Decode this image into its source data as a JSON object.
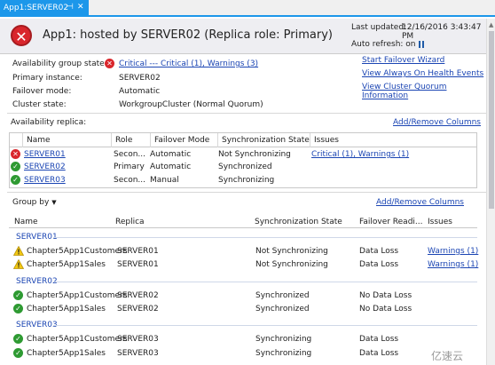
{
  "tab": {
    "title": "App1:SERVER02",
    "pin": "⊣",
    "close": "✕"
  },
  "header": {
    "title": "App1: hosted by SERVER02 (Replica role: Primary)",
    "last_updated_label": "Last updated:",
    "last_updated_value": "12/16/2016 3:43:47 PM",
    "auto_refresh_label": "Auto refresh: on"
  },
  "summary": {
    "ag_state_label": "Availability group state:",
    "ag_state_value": "Critical --- Critical (1), Warnings (3)",
    "primary_label": "Primary instance:",
    "primary_value": "SERVER02",
    "failover_label": "Failover mode:",
    "failover_value": "Automatic",
    "cluster_label": "Cluster state:",
    "cluster_value": "WorkgroupCluster (Normal Quorum)"
  },
  "links": {
    "wizard": "Start Failover Wizard",
    "health": "View Always On Health Events",
    "quorum": "View Cluster Quorum Information"
  },
  "replica_section": {
    "title": "Availability replica:",
    "add_remove": "Add/Remove Columns",
    "columns": [
      "Name",
      "Role",
      "Failover Mode",
      "Synchronization State",
      "Issues"
    ],
    "rows": [
      {
        "status": "error",
        "name": "SERVER01",
        "role": "Secon...",
        "failover": "Automatic",
        "sync": "Not Synchronizing",
        "issues": "Critical (1), Warnings (1)"
      },
      {
        "status": "ok",
        "name": "SERVER02",
        "role": "Primary",
        "failover": "Automatic",
        "sync": "Synchronized",
        "issues": ""
      },
      {
        "status": "ok",
        "name": "SERVER03",
        "role": "Secon...",
        "failover": "Manual",
        "sync": "Synchronizing",
        "issues": ""
      }
    ]
  },
  "db_section": {
    "group_by": "Group by",
    "add_remove": "Add/Remove Columns",
    "columns": [
      "Name",
      "Replica",
      "Synchronization State",
      "Failover Readi...",
      "Issues"
    ],
    "groups": [
      {
        "label": "SERVER01",
        "rows": [
          {
            "status": "warn",
            "name": "Chapter5App1Customers",
            "replica": "SERVER01",
            "sync": "Not Synchronizing",
            "failover": "Data Loss",
            "issues": "Warnings (1)"
          },
          {
            "status": "warn",
            "name": "Chapter5App1Sales",
            "replica": "SERVER01",
            "sync": "Not Synchronizing",
            "failover": "Data Loss",
            "issues": "Warnings (1)"
          }
        ]
      },
      {
        "label": "SERVER02",
        "rows": [
          {
            "status": "ok",
            "name": "Chapter5App1Customers",
            "replica": "SERVER02",
            "sync": "Synchronized",
            "failover": "No Data Loss",
            "issues": ""
          },
          {
            "status": "ok",
            "name": "Chapter5App1Sales",
            "replica": "SERVER02",
            "sync": "Synchronized",
            "failover": "No Data Loss",
            "issues": ""
          }
        ]
      },
      {
        "label": "SERVER03",
        "rows": [
          {
            "status": "ok",
            "name": "Chapter5App1Customers",
            "replica": "SERVER03",
            "sync": "Synchronizing",
            "failover": "Data Loss",
            "issues": ""
          },
          {
            "status": "ok",
            "name": "Chapter5App1Sales",
            "replica": "SERVER03",
            "sync": "Synchronizing",
            "failover": "Data Loss",
            "issues": ""
          }
        ]
      }
    ]
  },
  "watermark": "亿速云",
  "colors": {
    "tab": "#1c97ea",
    "error": "#d9262c",
    "ok": "#2e9a32",
    "warn": "#f2c811",
    "link": "#1b45b3"
  }
}
